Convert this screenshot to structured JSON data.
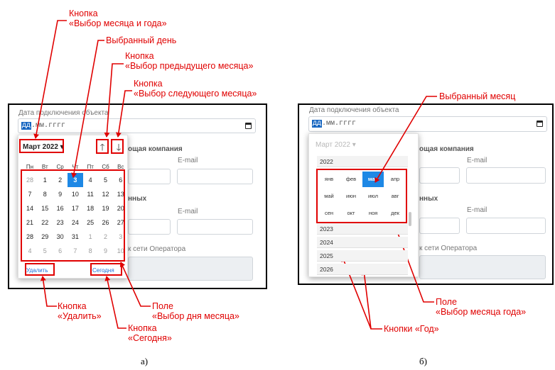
{
  "colors": {
    "annotation": "#e00000",
    "accent": "#1e88e5"
  },
  "form": {
    "date_label": "Дата подключения объекта",
    "date_value_day": "дд",
    "date_value_rest": ".мм.гггг",
    "company_heading": "ощая компания",
    "email_label": "E-mail",
    "data_heading": "нных",
    "operator_label": "к сети Оператора"
  },
  "calendar_a": {
    "month_title": "Март 2022",
    "prev_arrow": "🡑",
    "next_arrow": "🡓",
    "weekdays": [
      "Пн",
      "Вт",
      "Ср",
      "Чт",
      "Пт",
      "Сб",
      "Вс"
    ],
    "weeks": [
      [
        "28",
        "1",
        "2",
        "3",
        "4",
        "5",
        "6"
      ],
      [
        "7",
        "8",
        "9",
        "10",
        "11",
        "12",
        "13"
      ],
      [
        "14",
        "15",
        "16",
        "17",
        "18",
        "19",
        "20"
      ],
      [
        "21",
        "22",
        "23",
        "24",
        "25",
        "26",
        "27"
      ],
      [
        "28",
        "29",
        "30",
        "31",
        "1",
        "2",
        "3"
      ],
      [
        "4",
        "5",
        "6",
        "7",
        "8",
        "9",
        "10"
      ]
    ],
    "clear_label": "Удалить",
    "today_label": "Сегодня"
  },
  "calendar_b": {
    "month_title": "Март 2022",
    "years_before": [
      "2022"
    ],
    "months": [
      "янв",
      "фев",
      "мар",
      "апр",
      "май",
      "июн",
      "июл",
      "авг",
      "сен",
      "окт",
      "ноя",
      "дек"
    ],
    "years_after": [
      "2023",
      "2024",
      "2025",
      "2026"
    ]
  },
  "annotations": {
    "month_year_button": [
      "Кнопка",
      "«Выбор месяца и года»"
    ],
    "selected_day": "Выбранный день",
    "prev_month_button": [
      "Кнопка",
      "«Выбор предыдущего месяца»"
    ],
    "next_month_button": [
      "Кнопка",
      "«Выбор следующего месяца»"
    ],
    "clear_button": [
      "Кнопка",
      "«Удалить»"
    ],
    "day_field": [
      "Поле",
      "«Выбор дня месяца»"
    ],
    "today_button": [
      "Кнопка",
      "«Сегодня»"
    ],
    "selected_month": "Выбранный месяц",
    "month_field": [
      "Поле",
      "«Выбор месяца года»"
    ],
    "year_buttons": "Кнопки «Год»"
  },
  "captions": {
    "a": "а)",
    "b": "б)"
  }
}
